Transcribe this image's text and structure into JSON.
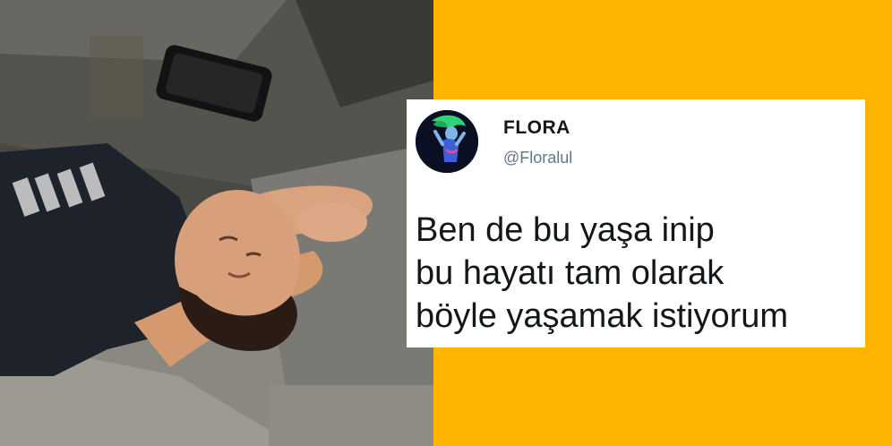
{
  "tweet": {
    "display_name": "FLORA",
    "handle": "@Floralul",
    "text_lines": [
      "Ben de bu yaşa inip",
      "bu hayatı tam olarak",
      "böyle yaşamak istiyorum"
    ]
  },
  "photo": {
    "shirt_print": "CULT",
    "icons": [
      "phone-icon"
    ]
  },
  "colors": {
    "background": "#ffb400",
    "card": "#ffffff",
    "handle": "#657786",
    "text": "#14171a"
  }
}
